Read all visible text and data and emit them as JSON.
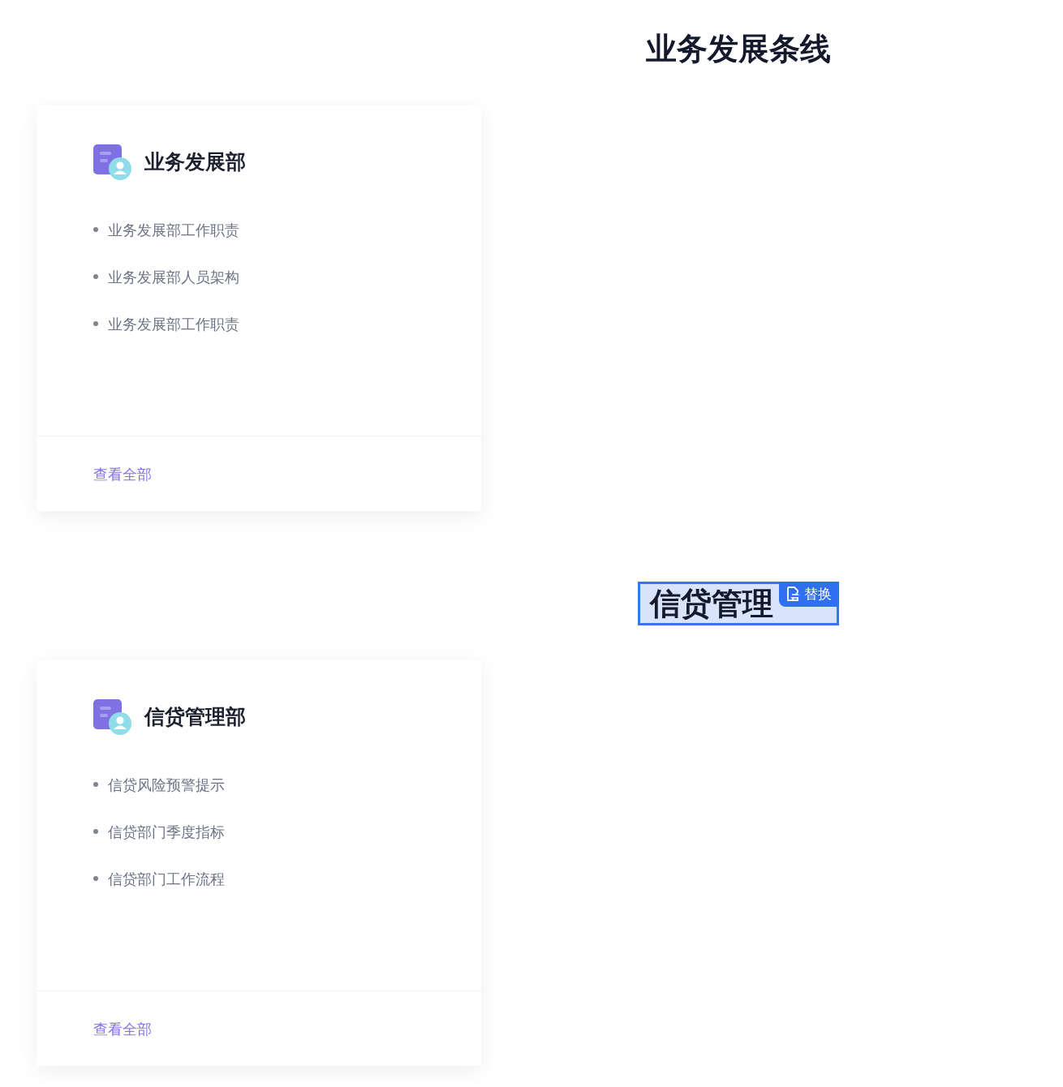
{
  "sections": [
    {
      "heading": {
        "text": "业务发展条线",
        "selected": false
      },
      "card": {
        "title": "业务发展部",
        "items": [
          "业务发展部工作职责",
          "业务发展部人员架构",
          "业务发展部工作职责"
        ],
        "link": "查看全部"
      }
    },
    {
      "heading": {
        "text": "信贷管理",
        "selected": true,
        "replace_button": "替换"
      },
      "card": {
        "title": "信贷管理部",
        "items": [
          "信贷风险预警提示",
          "信贷部门季度指标",
          "信贷部门工作流程"
        ],
        "link": "查看全部"
      }
    }
  ]
}
